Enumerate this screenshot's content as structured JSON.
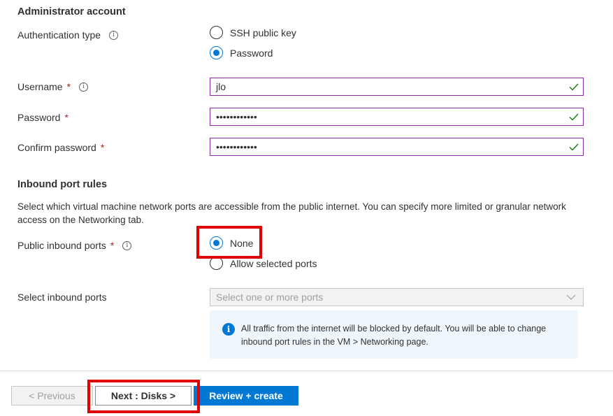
{
  "admin": {
    "title": "Administrator account",
    "auth_type_label": "Authentication type",
    "auth_options": [
      "SSH public key",
      "Password"
    ],
    "auth_selected": "Password",
    "username_label": "Username",
    "username_value": "jlo",
    "password_label": "Password",
    "password_value": "••••••••••••",
    "confirm_label": "Confirm password",
    "confirm_value": "••••••••••••",
    "required_mark": "*"
  },
  "inbound": {
    "title": "Inbound port rules",
    "description": "Select which virtual machine network ports are accessible from the public internet. You can specify more limited or granular network access on the Networking tab.",
    "public_ports_label": "Public inbound ports",
    "port_options": [
      "None",
      "Allow selected ports"
    ],
    "port_selected": "None",
    "select_ports_label": "Select inbound ports",
    "select_ports_placeholder": "Select one or more ports",
    "info_text": "All traffic from the internet will be blocked by default. You will be able to change inbound port rules in the VM > Networking page."
  },
  "footer": {
    "previous_label": "< Previous",
    "next_label": "Next : Disks >",
    "review_label": "Review + create"
  },
  "icons": {
    "info": "info-icon",
    "check": "checkmark-icon",
    "chevron": "chevron-down-icon"
  },
  "colors": {
    "accent": "#0078d4",
    "valid_check": "#107c10",
    "field_border": "#8a2ca0",
    "highlight": "#e00000",
    "required": "#a4262c"
  }
}
